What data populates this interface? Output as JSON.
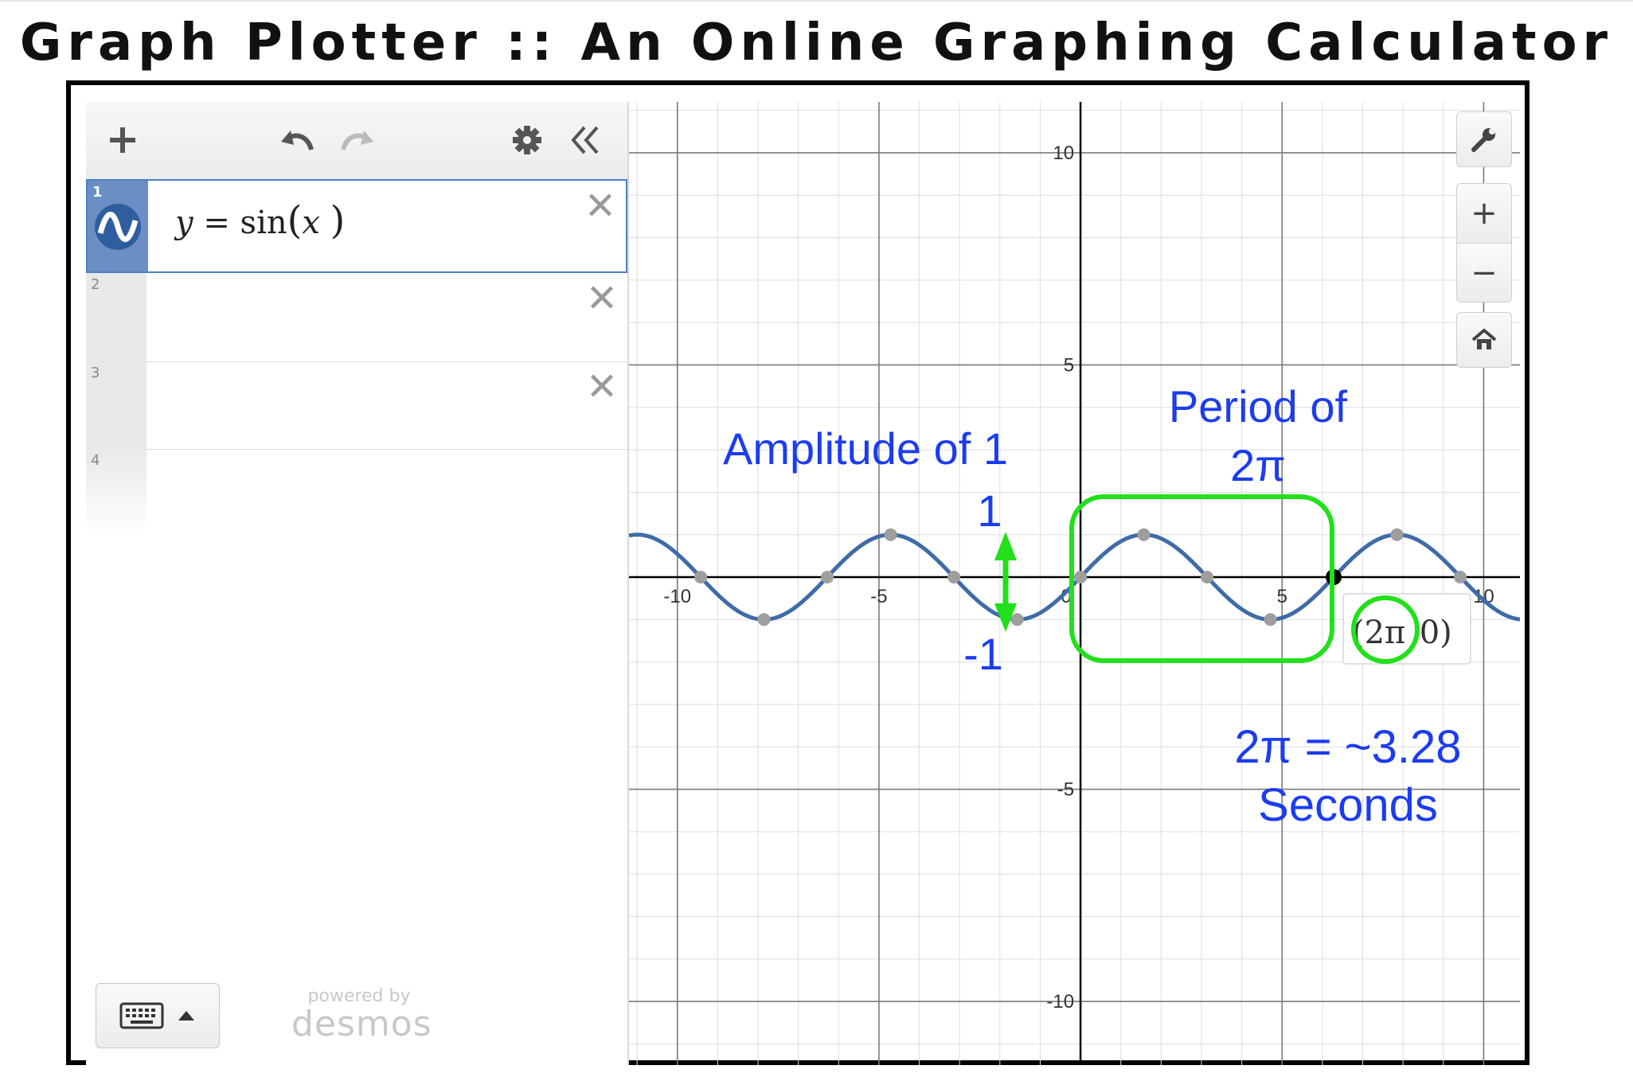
{
  "page": {
    "title": "Graph Plotter :: An Online Graphing Calculator"
  },
  "colors": {
    "curve": "#3f6ca8",
    "point": "#9e9e9e",
    "annotation": "#1c3cf0",
    "highlight": "#22e01b"
  },
  "toolbar": {
    "add_icon": "plus-icon",
    "undo_icon": "undo-icon",
    "redo_icon": "redo-icon",
    "settings_icon": "gear-icon",
    "collapse_icon": "double-chevron-left-icon"
  },
  "expressions": [
    {
      "num": "1",
      "y": "y",
      "eq": " = sin",
      "x": "x",
      "active": true
    },
    {
      "num": "2",
      "active": false
    },
    {
      "num": "3",
      "active": false
    },
    {
      "num": "4",
      "active": false
    }
  ],
  "footer": {
    "powered_by": "powered by",
    "brand": "desmos"
  },
  "graph_controls": {
    "wrench_icon": "wrench-icon",
    "zoom_in": "+",
    "zoom_out": "−",
    "home_icon": "home-icon"
  },
  "chart_data": {
    "type": "line",
    "function": "y = sin(x)",
    "xlim": [
      -11.2,
      10.9
    ],
    "ylim": [
      -11.5,
      11.2
    ],
    "x_ticks": [
      "-10",
      "-5",
      "0",
      "5",
      "10"
    ],
    "y_ticks": [
      "10",
      "5",
      "-5",
      "-10"
    ],
    "grid": true,
    "marked_points": [
      {
        "x": -9.42,
        "y": 0
      },
      {
        "x": -7.85,
        "y": -1
      },
      {
        "x": -6.28,
        "y": 0
      },
      {
        "x": -4.71,
        "y": 1
      },
      {
        "x": -3.14,
        "y": 0
      },
      {
        "x": -1.57,
        "y": -1
      },
      {
        "x": 0,
        "y": 0
      },
      {
        "x": 1.57,
        "y": 1
      },
      {
        "x": 3.14,
        "y": 0
      },
      {
        "x": 4.71,
        "y": -1
      },
      {
        "x": 6.28,
        "y": 0
      },
      {
        "x": 7.85,
        "y": 1
      },
      {
        "x": 9.42,
        "y": 0
      }
    ],
    "selected_point": {
      "x": 6.28,
      "y": 0,
      "label_a": "(2π",
      "label_b": ",0)"
    }
  },
  "annotations": {
    "amplitude": "Amplitude of 1",
    "plus_one": "1",
    "minus_one": "-1",
    "period_line1": "Period of",
    "period_line2": "2π",
    "approx_line1": "2π = ~3.28",
    "approx_line2": "Seconds"
  }
}
